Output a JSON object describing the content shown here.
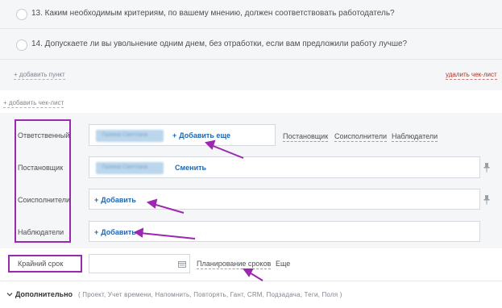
{
  "checklist": {
    "items": [
      {
        "text": "13. Каким необходимым критериям, по вашему мнению, должен соответствовать работодатель?"
      },
      {
        "text": "14. Допускаете ли вы увольнение одним днем, без отработки, если вам предложили работу лучше?"
      }
    ],
    "add_item": "+ добавить пункт",
    "delete_checklist": "удалить чек-лист"
  },
  "add_checklist": "+ добавить чек-лист",
  "rows": {
    "responsible": {
      "label": "Ответственный",
      "person": "Галина Светлана",
      "action": "Добавить еще",
      "role_links": [
        "Постановщик",
        "Соисполнители",
        "Наблюдатели"
      ]
    },
    "creator": {
      "label": "Постановщик",
      "person": "Галина Светлана",
      "action": "Сменить"
    },
    "coexecutors": {
      "label": "Соисполнители",
      "action": "Добавить"
    },
    "observers": {
      "label": "Наблюдатели",
      "action": "Добавить"
    }
  },
  "deadline": {
    "label": "Крайний срок",
    "value": "",
    "planning": "Планирование сроков",
    "more": "Еще"
  },
  "extra": {
    "title": "Дополнительно",
    "list": "( Проект, Учет времени, Напомнить, Повторять, Гант, CRM, Подзадача, Теги, Поля )"
  },
  "colors": {
    "annotation": "#9c27b0",
    "link": "#2067b0",
    "danger": "#a7382e"
  },
  "icons": {
    "calendar": "calendar-icon",
    "pin": "pin-icon",
    "chevron": "chevron-down-icon"
  }
}
